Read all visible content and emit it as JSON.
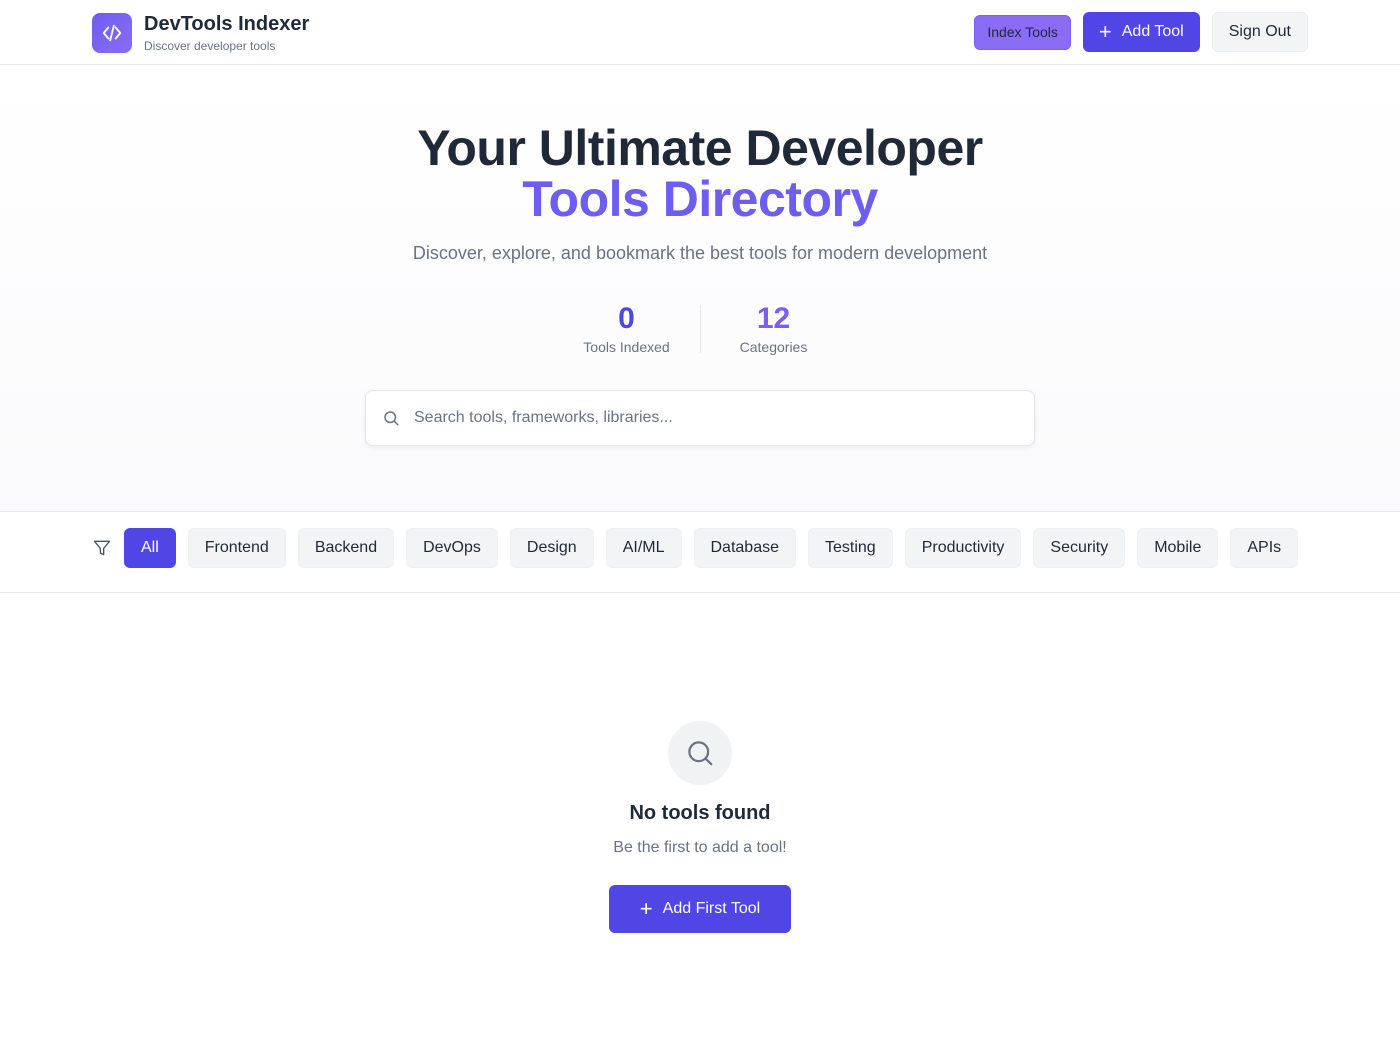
{
  "header": {
    "brand_title": "DevTools Indexer",
    "brand_subtitle": "Discover developer tools",
    "logo_icon": "code-icon",
    "index_label": "Index Tools",
    "add_label": "Add Tool",
    "signout_label": "Sign Out"
  },
  "hero": {
    "title_line1": "Your Ultimate Developer",
    "title_line2": "Tools Directory",
    "subtitle": "Discover, explore, and bookmark the best tools for modern development",
    "stats": [
      {
        "value": "0",
        "label": "Tools Indexed"
      },
      {
        "value": "12",
        "label": "Categories"
      }
    ],
    "search": {
      "placeholder": "Search tools, frameworks, libraries...",
      "value": ""
    }
  },
  "filters": {
    "icon": "filter-icon",
    "categories": [
      "All",
      "Frontend",
      "Backend",
      "DevOps",
      "Design",
      "AI/ML",
      "Database",
      "Testing",
      "Productivity",
      "Security",
      "Mobile",
      "APIs"
    ],
    "active": "All"
  },
  "empty": {
    "icon": "search-icon",
    "title": "No tools found",
    "subtitle": "Be the first to add a tool!",
    "button_label": "Add First Tool"
  },
  "colors": {
    "primary": "#4f46e5",
    "accent": "#6d5df0",
    "index_button": "#8b6cf5"
  }
}
